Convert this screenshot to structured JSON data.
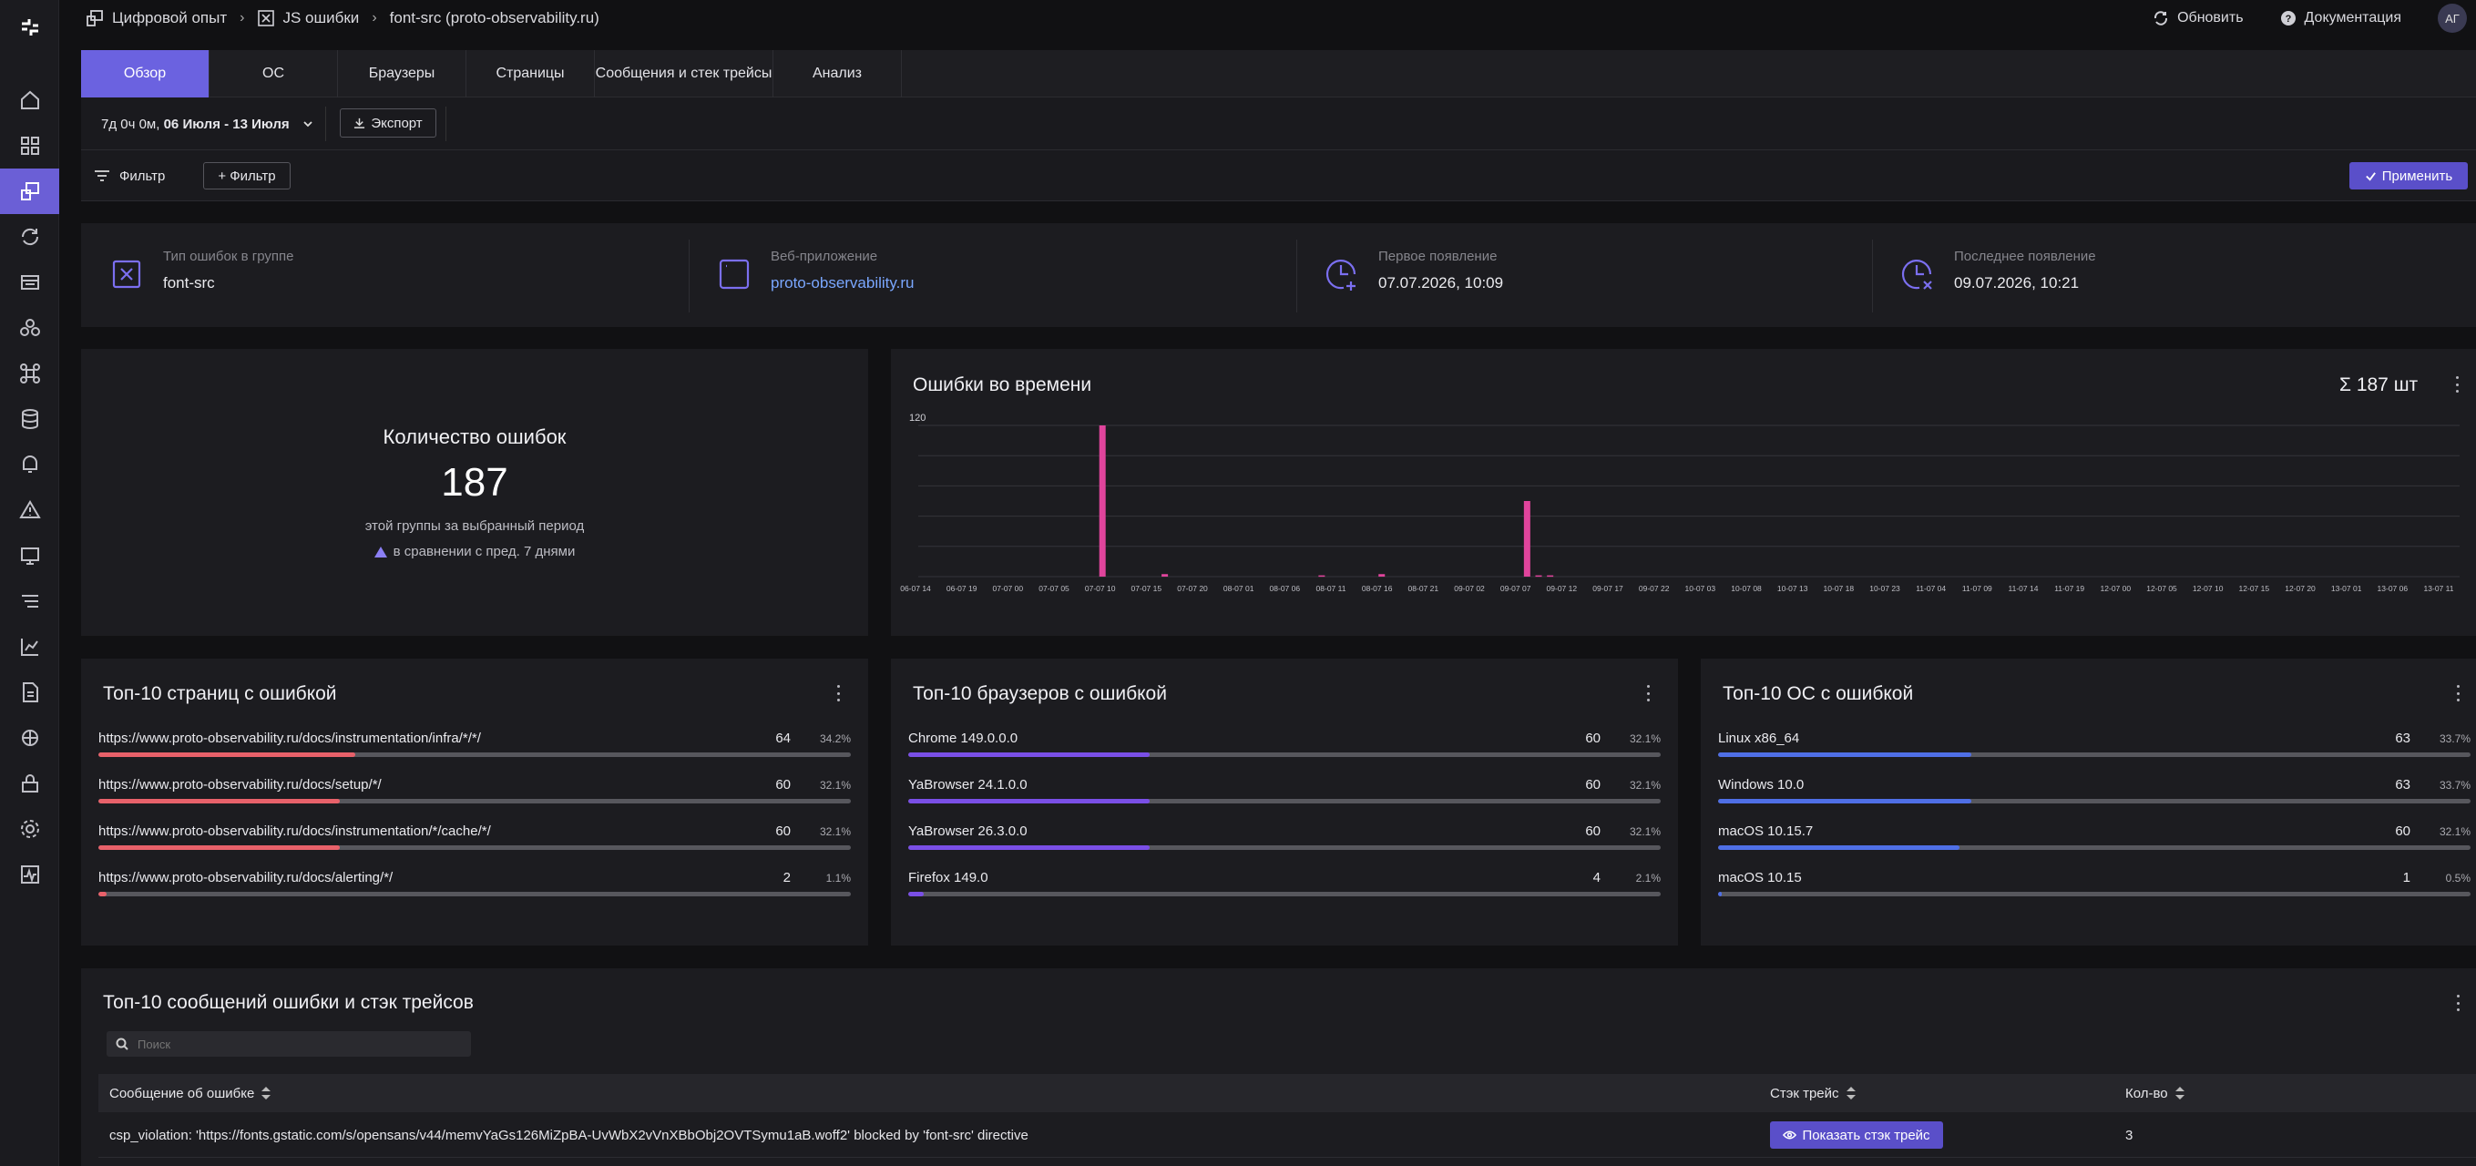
{
  "breadcrumb": {
    "items": [
      "Цифровой опыт",
      "JS ошибки",
      "font-src (proto-observability.ru)"
    ]
  },
  "topbar": {
    "refresh_label": "Обновить",
    "docs_label": "Документация",
    "avatar_initials": "АГ"
  },
  "tabs": [
    {
      "label": "Обзор",
      "active": true
    },
    {
      "label": "ОС",
      "active": false
    },
    {
      "label": "Браузеры",
      "active": false
    },
    {
      "label": "Страницы",
      "active": false
    },
    {
      "label": "Сообщения и стек трейсы",
      "active": false
    },
    {
      "label": "Анализ",
      "active": false
    }
  ],
  "daterange": {
    "duration": "7д 0ч 0м,",
    "range": "06 Июля - 13 Июля",
    "export_label": "Экспорт"
  },
  "filter": {
    "label": "Фильтр",
    "add_label": "+ Фильтр",
    "apply_label": "Применить"
  },
  "info": {
    "error_type_label": "Тип ошибок в группе",
    "error_type_value": "font-src",
    "webapp_label": "Веб-приложение",
    "webapp_value": "proto-observability.ru",
    "first_label": "Первое появление",
    "first_value": "07.07.2026, 10:09",
    "last_label": "Последнее появление",
    "last_value": "09.07.2026, 10:21"
  },
  "count_panel": {
    "title": "Количество ошибок",
    "value": "187",
    "subtitle": "этой группы за выбранный период",
    "compare": "в сравнении с пред. 7 днями"
  },
  "chart_panel": {
    "title": "Ошибки во времени",
    "total": "Σ 187 шт"
  },
  "chart_data": {
    "type": "bar",
    "title": "Ошибки во времени",
    "ylim": [
      0,
      120
    ],
    "ytick_labels": [
      "120"
    ],
    "xtick_labels": [
      "06-07 14",
      "06-07 19",
      "07-07 00",
      "07-07 05",
      "07-07 10",
      "07-07 15",
      "07-07 20",
      "08-07 01",
      "08-07 06",
      "08-07 11",
      "08-07 16",
      "08-07 21",
      "09-07 02",
      "09-07 07",
      "09-07 12",
      "09-07 17",
      "09-07 22",
      "10-07 03",
      "10-07 08",
      "10-07 13",
      "10-07 18",
      "10-07 23",
      "11-07 04",
      "11-07 09",
      "11-07 14",
      "11-07 19",
      "12-07 00",
      "12-07 05",
      "12-07 10",
      "12-07 15",
      "12-07 20",
      "13-07 01",
      "13-07 06",
      "13-07 11"
    ],
    "bars": [
      {
        "x": 4.05,
        "value": 120
      },
      {
        "x": 5.4,
        "value": 2
      },
      {
        "x": 8.8,
        "value": 1
      },
      {
        "x": 10.1,
        "value": 2
      },
      {
        "x": 13.25,
        "value": 60
      },
      {
        "x": 13.5,
        "value": 1
      },
      {
        "x": 13.75,
        "value": 1
      }
    ],
    "color": "#e0449c"
  },
  "top_pages": {
    "title": "Топ-10 страниц с ошибкой",
    "color": "#e8616a",
    "rows": [
      {
        "label": "https://www.proto-observability.ru/docs/instrumentation/infra/*/*/",
        "count": "64",
        "pct": "34.2%",
        "frac": 0.342
      },
      {
        "label": "https://www.proto-observability.ru/docs/setup/*/",
        "count": "60",
        "pct": "32.1%",
        "frac": 0.321
      },
      {
        "label": "https://www.proto-observability.ru/docs/instrumentation/*/cache/*/",
        "count": "60",
        "pct": "32.1%",
        "frac": 0.321
      },
      {
        "label": "https://www.proto-observability.ru/docs/alerting/*/",
        "count": "2",
        "pct": "1.1%",
        "frac": 0.011
      }
    ]
  },
  "top_browsers": {
    "title": "Топ-10 браузеров с ошибкой",
    "color": "#7a4fe6",
    "rows": [
      {
        "label": "Chrome 149.0.0.0",
        "count": "60",
        "pct": "32.1%",
        "frac": 0.321
      },
      {
        "label": "YaBrowser 24.1.0.0",
        "count": "60",
        "pct": "32.1%",
        "frac": 0.321
      },
      {
        "label": "YaBrowser 26.3.0.0",
        "count": "60",
        "pct": "32.1%",
        "frac": 0.321
      },
      {
        "label": "Firefox 149.0",
        "count": "4",
        "pct": "2.1%",
        "frac": 0.021
      }
    ]
  },
  "top_os": {
    "title": "Топ-10 ОС с ошибкой",
    "color": "#4f6fe6",
    "rows": [
      {
        "label": "Linux x86_64",
        "count": "63",
        "pct": "33.7%",
        "frac": 0.337
      },
      {
        "label": "Windows 10.0",
        "count": "63",
        "pct": "33.7%",
        "frac": 0.337
      },
      {
        "label": "macOS 10.15.7",
        "count": "60",
        "pct": "32.1%",
        "frac": 0.321
      },
      {
        "label": "macOS 10.15",
        "count": "1",
        "pct": "0.5%",
        "frac": 0.005
      }
    ]
  },
  "messages": {
    "title": "Топ-10 сообщений ошибки и стэк трейсов",
    "search_placeholder": "Поиск",
    "col_message": "Сообщение об ошибке",
    "col_stack": "Стэк трейс",
    "col_count": "Кол-во",
    "rows": [
      {
        "message": "csp_violation: 'https://fonts.gstatic.com/s/opensans/v44/memvYaGs126MiZpBA-UvWbX2vVnXBbObj2OVTSymu1aB.woff2' blocked by 'font-src' directive",
        "button": "Показать стэк трейс",
        "count": "3"
      }
    ]
  }
}
